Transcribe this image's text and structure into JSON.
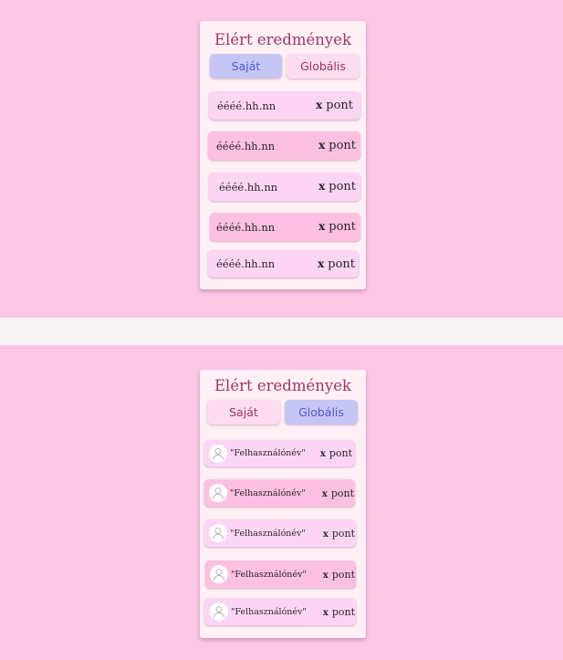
{
  "own_view": {
    "title": "Elért eredmények",
    "tabs": {
      "own": "Saját",
      "global": "Globális",
      "active": "own"
    },
    "rows": [
      {
        "date": "éééé.hh.nn",
        "score": "x",
        "unit": "pont"
      },
      {
        "date": "éééé.hh.nn",
        "score": "x",
        "unit": "pont"
      },
      {
        "date": "éééé.hh.nn",
        "score": "x",
        "unit": "pont"
      },
      {
        "date": "éééé.hh.nn",
        "score": "x",
        "unit": "pont"
      },
      {
        "date": "éééé.hh.nn",
        "score": "x",
        "unit": "pont"
      }
    ]
  },
  "global_view": {
    "title": "Elért eredmények",
    "tabs": {
      "own": "Saját",
      "global": "Globális",
      "active": "global"
    },
    "rows": [
      {
        "icon": "user-avatar-icon",
        "username": "\"Felhasználónév\"",
        "score": "x",
        "unit": "pont"
      },
      {
        "icon": "user-avatar-icon",
        "username": "\"Felhasználónév\"",
        "score": "x",
        "unit": "pont"
      },
      {
        "icon": "user-avatar-icon",
        "username": "\"Felhasználónév\"",
        "score": "x",
        "unit": "pont"
      },
      {
        "icon": "user-avatar-icon",
        "username": "\"Felhasználónév\"",
        "score": "x",
        "unit": "pont"
      },
      {
        "icon": "user-avatar-icon",
        "username": "\"Felhasználónév\"",
        "score": "x",
        "unit": "pont"
      }
    ]
  },
  "colors": {
    "background": "#fcc8e5",
    "card": "#fff0f5",
    "title": "#a03468",
    "active_tab": "#c5c6f4",
    "inactive_tab": "#fcdcee",
    "row_light": "#fcd5f5",
    "row_dark": "#fcc0e2"
  }
}
